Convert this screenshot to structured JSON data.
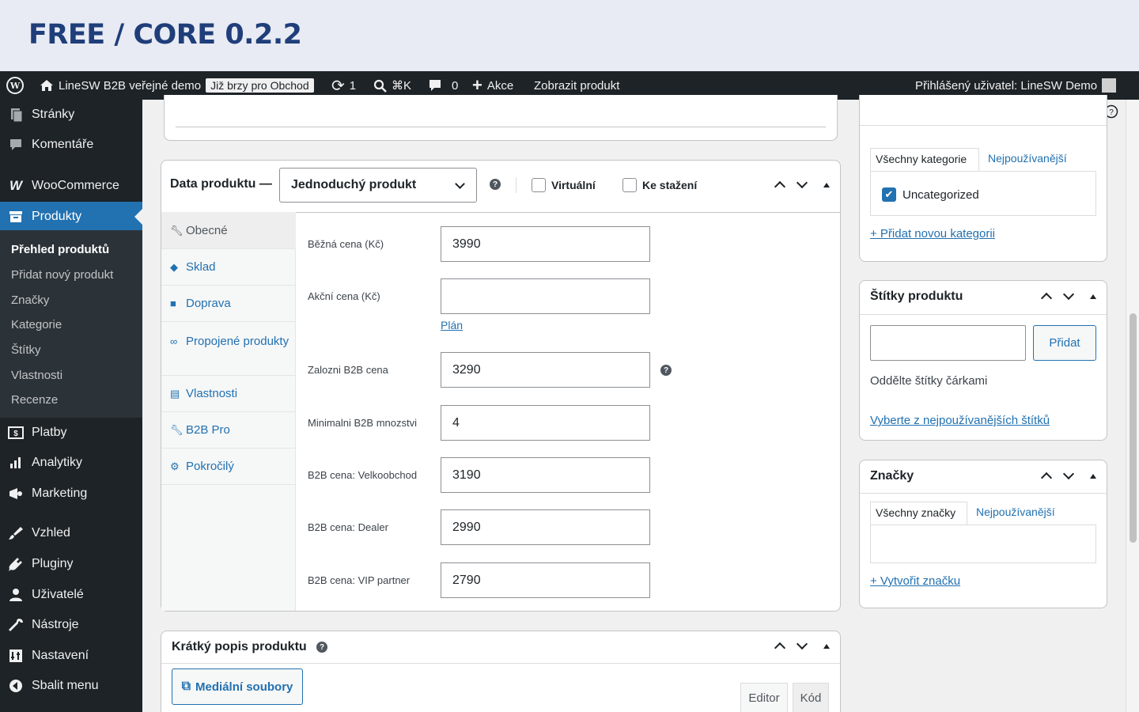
{
  "banner": {
    "title": "FREE / CORE 0.2.2"
  },
  "adminbar": {
    "site_name": "LineSW B2B veřejné demo",
    "badge": "Již brzy pro Obchod",
    "updates_count": "1",
    "search_shortcut": "⌘K",
    "comments_count": "0",
    "new_label": "Akce",
    "view_product": "Zobrazit produkt",
    "user_greeting": "Přihlášený uživatel: LineSW Demo"
  },
  "sidebar": {
    "items": [
      {
        "label": "Stránky"
      },
      {
        "label": "Komentáře"
      },
      {
        "label": "WooCommerce"
      },
      {
        "label": "Produkty"
      },
      {
        "label": "Platby"
      },
      {
        "label": "Analytiky"
      },
      {
        "label": "Marketing"
      },
      {
        "label": "Vzhled"
      },
      {
        "label": "Pluginy"
      },
      {
        "label": "Uživatelé"
      },
      {
        "label": "Nástroje"
      },
      {
        "label": "Nastavení"
      },
      {
        "label": "Sbalit menu"
      }
    ],
    "submenu": [
      {
        "label": "Přehled produktů"
      },
      {
        "label": "Přidat nový produkt"
      },
      {
        "label": "Značky"
      },
      {
        "label": "Kategorie"
      },
      {
        "label": "Štítky"
      },
      {
        "label": "Vlastnosti"
      },
      {
        "label": "Recenze"
      }
    ]
  },
  "product_data": {
    "title": "Data produktu —",
    "type_selected": "Jednoduchý produkt",
    "virtual_label": "Virtuální",
    "downloadable_label": "Ke stažení",
    "tabs": [
      {
        "label": "Obecné"
      },
      {
        "label": "Sklad"
      },
      {
        "label": "Doprava"
      },
      {
        "label": "Propojené produkty"
      },
      {
        "label": "Vlastnosti"
      },
      {
        "label": "B2B Pro"
      },
      {
        "label": "Pokročilý"
      }
    ],
    "fields": [
      {
        "label": "Běžná cena (Kč)",
        "value": "3990"
      },
      {
        "label": "Akční cena (Kč)",
        "value": ""
      },
      {
        "label": "Zalozni B2B cena",
        "value": "3290"
      },
      {
        "label": "Minimalni B2B mnozstvi",
        "value": "4"
      },
      {
        "label": "B2B cena: Velkoobchod",
        "value": "3190"
      },
      {
        "label": "B2B cena: Dealer",
        "value": "2990"
      },
      {
        "label": "B2B cena: VIP partner",
        "value": "2790"
      }
    ],
    "schedule_link": "Plán"
  },
  "short_desc": {
    "title": "Krátký popis produktu",
    "media_button": "Mediální soubory",
    "editor_tab": "Editor",
    "code_tab": "Kód"
  },
  "categories": {
    "tab_all": "Všechny kategorie",
    "tab_popular": "Nejpoužívanější",
    "item": "Uncategorized",
    "add_link": "+ Přidat novou kategorii"
  },
  "tags": {
    "title": "Štítky produktu",
    "add_button": "Přidat",
    "hint": "Oddělte štítky čárkami",
    "choose_link": "Vyberte z nejpoužívanějších štítků"
  },
  "brands": {
    "title": "Značky",
    "tab_all": "Všechny značky",
    "tab_popular": "Nejpoužívanější",
    "create_link": "+ Vytvořit značku"
  },
  "colors": {
    "accent": "#2271b1",
    "adminbar": "#1d2327",
    "banner_text": "#1f3e7a"
  }
}
